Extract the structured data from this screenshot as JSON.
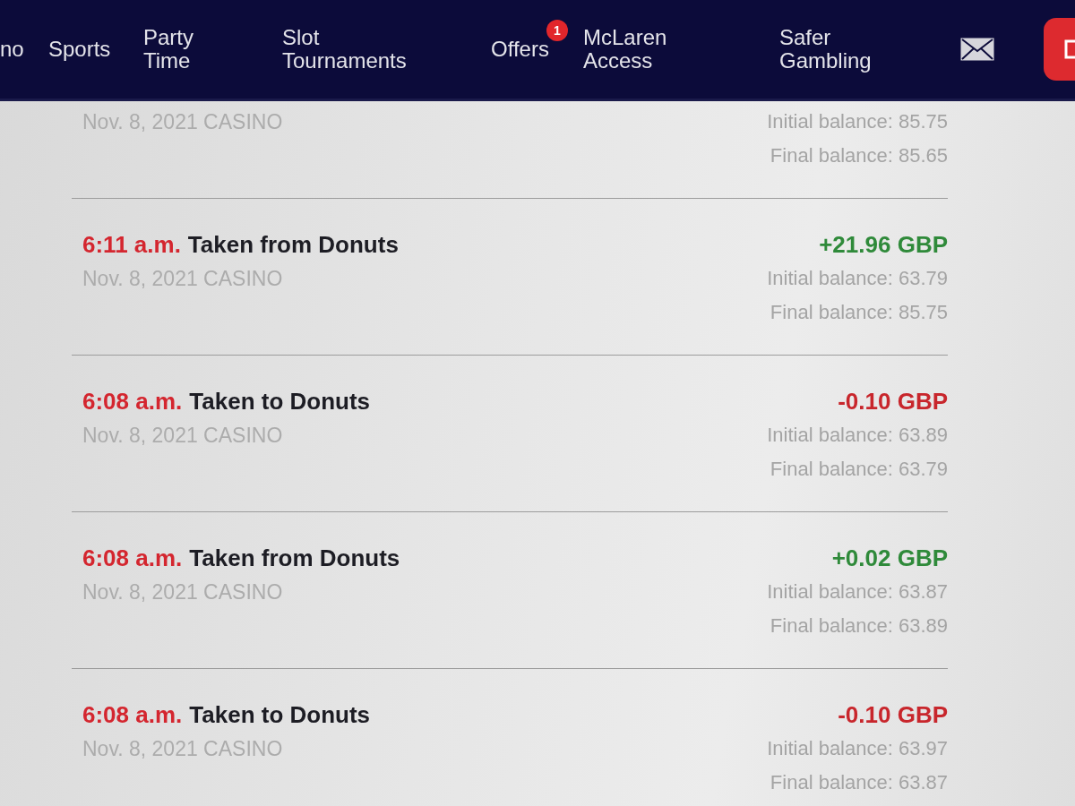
{
  "nav": {
    "items": [
      {
        "label": "no"
      },
      {
        "label": "Sports"
      },
      {
        "label": "Party Time"
      },
      {
        "label": "Slot Tournaments"
      },
      {
        "label": "Offers",
        "badge": "1"
      },
      {
        "label": "McLaren Access"
      },
      {
        "label": "Safer Gambling"
      }
    ]
  },
  "transactions": [
    {
      "meta": "Nov. 8, 2021 CASINO",
      "initial_balance": "Initial balance: 85.75",
      "final_balance": "Final balance: 85.65"
    },
    {
      "time": "6:11 a.m.",
      "title": "Taken from Donuts",
      "amount": "+21.96 GBP",
      "kind": "credit",
      "meta": "Nov. 8, 2021 CASINO",
      "initial_balance": "Initial balance: 63.79",
      "final_balance": "Final balance: 85.75"
    },
    {
      "time": "6:08 a.m.",
      "title": "Taken to Donuts",
      "amount": "-0.10 GBP",
      "kind": "debit",
      "meta": "Nov. 8, 2021 CASINO",
      "initial_balance": "Initial balance: 63.89",
      "final_balance": "Final balance: 63.79"
    },
    {
      "time": "6:08 a.m.",
      "title": "Taken from Donuts",
      "amount": "+0.02 GBP",
      "kind": "credit",
      "meta": "Nov. 8, 2021 CASINO",
      "initial_balance": "Initial balance: 63.87",
      "final_balance": "Final balance: 63.89"
    },
    {
      "time": "6:08 a.m.",
      "title": "Taken to Donuts",
      "amount": "-0.10 GBP",
      "kind": "debit",
      "meta": "Nov. 8, 2021 CASINO",
      "initial_balance": "Initial balance: 63.97",
      "final_balance": "Final balance: 63.87"
    }
  ]
}
